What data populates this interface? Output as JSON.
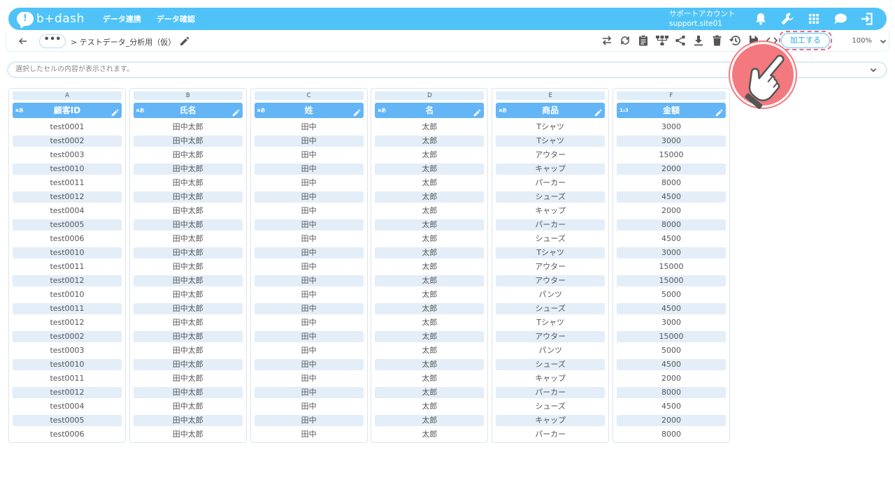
{
  "app": {
    "logo_text": "b+dash",
    "brand_color": "#4fc3f7"
  },
  "nav": {
    "data_link": "データ連携",
    "data_check": "データ確認"
  },
  "account": {
    "name": "サポートアカウント",
    "site": "support.site01"
  },
  "top_icons": [
    "bell-icon",
    "wrench-icon",
    "apps-grid-icon",
    "chat-icon",
    "logout-icon"
  ],
  "breadcrumb": {
    "more": "•••",
    "title": "> テストデータ_分析用（仮）"
  },
  "toolbar": {
    "process_label": "加工する",
    "zoom": "100%"
  },
  "cellbar": {
    "placeholder": "選択したセルの内容が表示されます。"
  },
  "columns": [
    {
      "letter": "A",
      "type": "aあ",
      "name": "顧客ID"
    },
    {
      "letter": "B",
      "type": "aあ",
      "name": "氏名"
    },
    {
      "letter": "C",
      "type": "aあ",
      "name": "姓"
    },
    {
      "letter": "D",
      "type": "aあ",
      "name": "名"
    },
    {
      "letter": "E",
      "type": "aあ",
      "name": "商品"
    },
    {
      "letter": "F",
      "type": "1₂3",
      "name": "金額"
    }
  ],
  "rows": [
    [
      "test0001",
      "田中太郎",
      "田中",
      "太郎",
      "Tシャツ",
      "3000"
    ],
    [
      "test0002",
      "田中太郎",
      "田中",
      "太郎",
      "Tシャツ",
      "3000"
    ],
    [
      "test0003",
      "田中太郎",
      "田中",
      "太郎",
      "アウター",
      "15000"
    ],
    [
      "test0010",
      "田中太郎",
      "田中",
      "太郎",
      "キャップ",
      "2000"
    ],
    [
      "test0011",
      "田中太郎",
      "田中",
      "太郎",
      "パーカー",
      "8000"
    ],
    [
      "test0012",
      "田中太郎",
      "田中",
      "太郎",
      "シューズ",
      "4500"
    ],
    [
      "test0004",
      "田中太郎",
      "田中",
      "太郎",
      "キャップ",
      "2000"
    ],
    [
      "test0005",
      "田中太郎",
      "田中",
      "太郎",
      "パーカー",
      "8000"
    ],
    [
      "test0006",
      "田中太郎",
      "田中",
      "太郎",
      "シューズ",
      "4500"
    ],
    [
      "test0010",
      "田中太郎",
      "田中",
      "太郎",
      "Tシャツ",
      "3000"
    ],
    [
      "test0011",
      "田中太郎",
      "田中",
      "太郎",
      "アウター",
      "15000"
    ],
    [
      "test0012",
      "田中太郎",
      "田中",
      "太郎",
      "アウター",
      "15000"
    ],
    [
      "test0010",
      "田中太郎",
      "田中",
      "太郎",
      "パンツ",
      "5000"
    ],
    [
      "test0011",
      "田中太郎",
      "田中",
      "太郎",
      "シューズ",
      "4500"
    ],
    [
      "test0012",
      "田中太郎",
      "田中",
      "太郎",
      "Tシャツ",
      "3000"
    ],
    [
      "test0002",
      "田中太郎",
      "田中",
      "太郎",
      "アウター",
      "15000"
    ],
    [
      "test0003",
      "田中太郎",
      "田中",
      "太郎",
      "パンツ",
      "5000"
    ],
    [
      "test0010",
      "田中太郎",
      "田中",
      "太郎",
      "シューズ",
      "4500"
    ],
    [
      "test0011",
      "田中太郎",
      "田中",
      "太郎",
      "キャップ",
      "2000"
    ],
    [
      "test0012",
      "田中太郎",
      "田中",
      "太郎",
      "パーカー",
      "8000"
    ],
    [
      "test0004",
      "田中太郎",
      "田中",
      "太郎",
      "シューズ",
      "4500"
    ],
    [
      "test0005",
      "田中太郎",
      "田中",
      "太郎",
      "キャップ",
      "2000"
    ],
    [
      "test0006",
      "田中太郎",
      "田中",
      "太郎",
      "パーカー",
      "8000"
    ]
  ]
}
